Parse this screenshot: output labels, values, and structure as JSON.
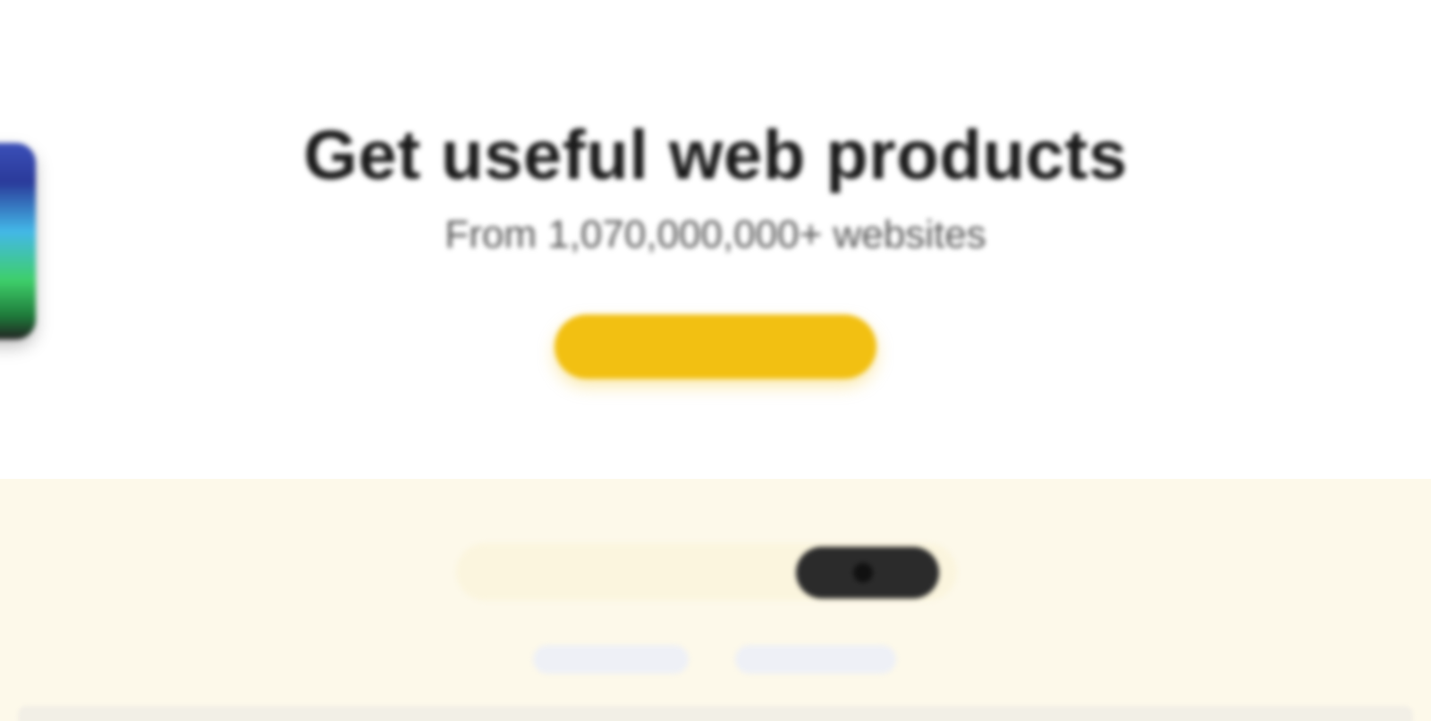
{
  "hero": {
    "title": "Get useful web products",
    "subtitle": "From 1,070,000,000+ websites",
    "cta_label": ""
  },
  "newsletter": {
    "text": "",
    "email_placeholder": "",
    "subscribe_label": ""
  },
  "footer": {
    "link_one": "",
    "link_two": ""
  },
  "colors": {
    "accent": "#f2c012",
    "newsletter_bg": "#fdf9ea",
    "button_dark": "#2b2b2b"
  },
  "icons": {
    "app_icon": "app-icon"
  }
}
